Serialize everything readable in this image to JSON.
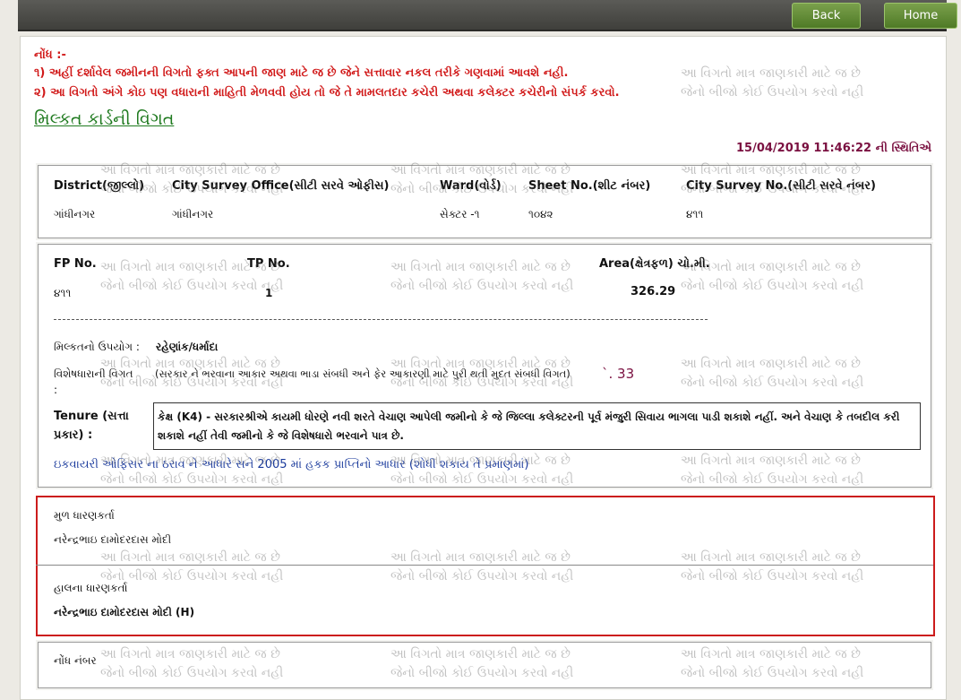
{
  "nav": {
    "back_label": "Back",
    "home_label": "Home"
  },
  "notice": {
    "heading": "નોંધ :-",
    "line1": "૧) અહીં દર્શાવેલ જમીનની વિગતો ફક્ત આપની જાણ માટે જ છે જેને સત્તાવાર નકલ તરીકે ગણવામાં આવશે નહી.",
    "line2": "૨) આ વિગતો અંગે કોઇ પણ વધારાની માહિતી મેળવવી હોય તો જે તે મામલતદાર કચેરી અથવા કલેક્ટર કચેરીનો સંપર્ક કરવો."
  },
  "title": "મિલ્કત કાર્ડની વિગત",
  "timestamp": "15/04/2019 11:46:22 ની સ્થિતિએ",
  "watermark": {
    "line1": "આ વિગતો માત્ર જાણકારી માટે જ છે",
    "line2": "જેનો બીજો કોઈ ઉપયોગ કરવો નહી"
  },
  "location": {
    "district_label": "District(જીલ્લો)",
    "city_survey_office_label": "City Survey Office(સીટી સરવે ઓફીસ)",
    "ward_label": "Ward(વોર્ડ)",
    "sheet_label": "Sheet No.(શીટ નંબર)",
    "city_survey_no_label": "City Survey No.(સીટી સરવે નંબર)",
    "district": "ગાંધીનગર",
    "city_survey_office": "ગાંધીનગર",
    "ward": "સેક્ટર -૧",
    "sheet": "૧૦૪૨",
    "city_survey_no": "૪૧૧"
  },
  "details": {
    "fp_label": "FP No.",
    "tp_label": "TP No.",
    "area_label": "Area(ક્ષેત્રફળ) ચો.મી.",
    "fp": "૪૧૧",
    "tp": "1",
    "area": "326.29",
    "usage_label": "મિલ્કતનો ઉપયોગ :",
    "usage": "રહેણાંક/ધર્માદા",
    "special_label": "વિશેષધારાની વિગત",
    "special_colon": ":",
    "special_desc": "(સરકાર ને ભરવાના આકાર અથવા ભાડા સંબધી અને ફેર આકારણી માટે પુરી થતી મુદત સંબધી વિગત)",
    "special_amount": "`. 33",
    "tenure_label_1": "Tenure (સત્તા",
    "tenure_label_2": "પ્રકાર) :",
    "tenure_text": "કેક્ષ (K4) - સરકારશ્રીએ કાયમી ધોરણે નવી શરતે વેચાણ આપેલી જમીનો કે જે જિલ્લા કલેક્ટરની પૂર્વ મંજુરી સિવાય ભાગલા પાડી શકાશે નહીં. અને વેચાણ કે તબદીલ કરી શકાશે નહીં તેવી જમીનો કે જે વિશેષધારો ભરવાને પાત્ર છે.",
    "order_link": "ઇકવાયરી ઓફિસર ના ઠરાવ ને આધારે સને 2005 માં હકક પ્રાપ્તિનો આધાર (શોધી શકાય તે પ્રમાણમાં)"
  },
  "holders": {
    "original_label": "મુળ ધારણકર્તા",
    "original_name": "નરેન્દ્રભાઇ દામોદરદાસ મોદી",
    "current_label": "હાલના ધારણકર્તા",
    "current_name": "નરેન્દ્રભાઇ દામોદરદાસ મોદી (H)"
  },
  "note": {
    "label": "નોંધ નંબર"
  }
}
